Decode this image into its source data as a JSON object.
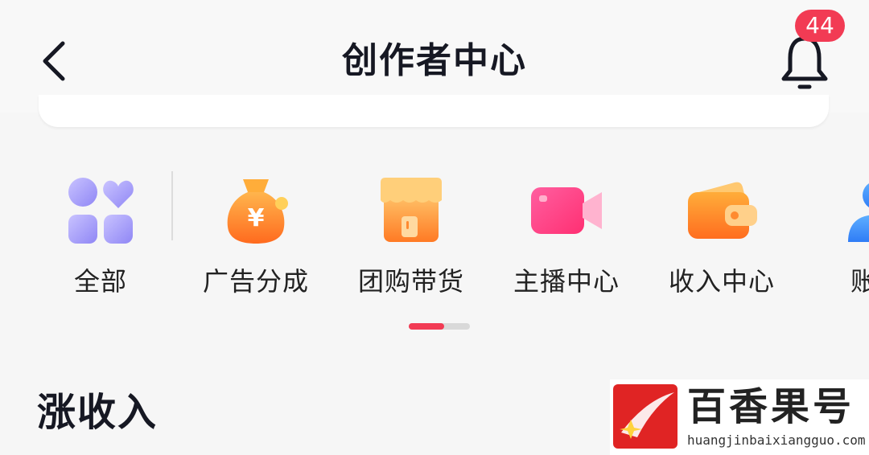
{
  "header": {
    "title": "创作者中心",
    "notification_count": "44"
  },
  "tools": [
    {
      "label": "全部",
      "icon": "grid-heart-icon"
    },
    {
      "label": "广告分成",
      "icon": "money-bag-icon"
    },
    {
      "label": "团购带货",
      "icon": "shop-icon"
    },
    {
      "label": "主播中心",
      "icon": "video-camera-icon"
    },
    {
      "label": "收入中心",
      "icon": "wallet-icon"
    },
    {
      "label": "账号",
      "icon": "user-icon"
    }
  ],
  "pager": {
    "active_fraction": 0.58
  },
  "section": {
    "title": "涨收入"
  },
  "watermark": {
    "text": "百香果号",
    "url": "huangjinbaixiangguo.com"
  },
  "colors": {
    "accent": "#f23b54",
    "background": "#f6f6f6"
  }
}
